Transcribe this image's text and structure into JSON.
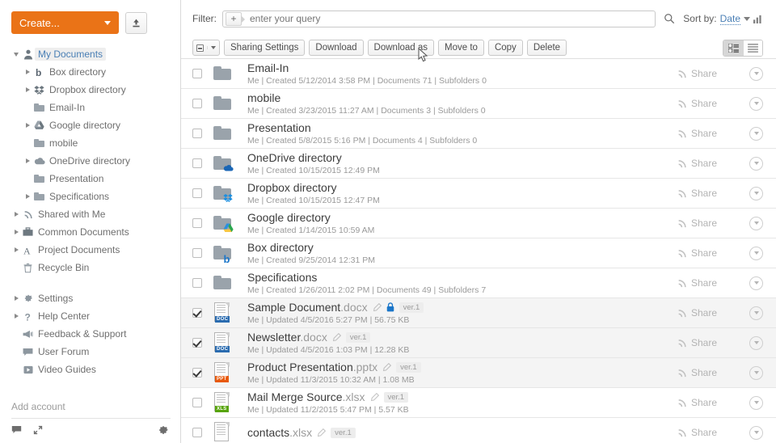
{
  "sidebar": {
    "create_button": {
      "label": "Create...",
      "color": "#ea7317"
    },
    "upload_button_name": "upload-icon",
    "tree": [
      {
        "label": "My Documents",
        "level": 1,
        "arrow": "down",
        "icon": "user-icon",
        "selected": true
      },
      {
        "label": "Box directory",
        "level": 2,
        "arrow": "right",
        "icon": "box-icon"
      },
      {
        "label": "Dropbox directory",
        "level": 2,
        "arrow": "right",
        "icon": "dropbox-icon"
      },
      {
        "label": "Email-In",
        "level": 2,
        "arrow": "none",
        "icon": "folder-icon"
      },
      {
        "label": "Google directory",
        "level": 2,
        "arrow": "right",
        "icon": "google-drive-icon"
      },
      {
        "label": "mobile",
        "level": 2,
        "arrow": "none",
        "icon": "folder-icon"
      },
      {
        "label": "OneDrive directory",
        "level": 2,
        "arrow": "right",
        "icon": "onedrive-icon"
      },
      {
        "label": "Presentation",
        "level": 2,
        "arrow": "none",
        "icon": "folder-icon"
      },
      {
        "label": "Specifications",
        "level": 2,
        "arrow": "right",
        "icon": "folder-icon"
      },
      {
        "label": "Shared with Me",
        "level": 1,
        "arrow": "right",
        "icon": "share-icon"
      },
      {
        "label": "Common Documents",
        "level": 1,
        "arrow": "right",
        "icon": "briefcase-icon"
      },
      {
        "label": "Project Documents",
        "level": 1,
        "arrow": "right",
        "icon": "project-icon"
      },
      {
        "label": "Recycle Bin",
        "level": 1,
        "arrow": "none",
        "icon": "trash-icon"
      }
    ],
    "tree_secondary": [
      {
        "label": "Settings",
        "level": 1,
        "arrow": "right",
        "icon": "gear-icon"
      },
      {
        "label": "Help Center",
        "level": 1,
        "arrow": "right",
        "icon": "question-icon"
      },
      {
        "label": "Feedback & Support",
        "level": 1,
        "arrow": "none",
        "icon": "megaphone-icon"
      },
      {
        "label": "User Forum",
        "level": 1,
        "arrow": "none",
        "icon": "chat-icon"
      },
      {
        "label": "Video Guides",
        "level": 1,
        "arrow": "none",
        "icon": "video-icon"
      }
    ],
    "add_account": "Add account",
    "footer_icons": [
      "chat-icon",
      "expand-icon",
      "gear-icon"
    ]
  },
  "toolbar": {
    "filter_label": "Filter:",
    "filter_placeholder": "enter your query",
    "filter_value": "",
    "plus_chip": "+",
    "search_icon": "search-icon",
    "sort_prefix": "Sort by:",
    "sort_value": "Date",
    "sort_order_icon": "sort-bars-icon",
    "select_all_icon": "checkbox-indeterminate-icon",
    "buttons": [
      "Sharing Settings",
      "Download",
      "Download as",
      "Move to",
      "Copy",
      "Delete"
    ],
    "view_detail_icon": "list-detail-view-icon",
    "view_list_icon": "list-compact-view-icon",
    "view_active": "detail"
  },
  "list": {
    "share_label": "Share",
    "rows": [
      {
        "name": "Email-In",
        "ext": "",
        "kind": "folder",
        "overlay": "none",
        "meta": "Me | Created 5/12/2014 3:58 PM | Documents 71 | Subfolders 0",
        "checked": false,
        "locked": false,
        "editable": false,
        "version": ""
      },
      {
        "name": "mobile",
        "ext": "",
        "kind": "folder",
        "overlay": "none",
        "meta": "Me | Created 3/23/2015 11:27 AM | Documents 3 | Subfolders 0",
        "checked": false,
        "locked": false,
        "editable": false,
        "version": ""
      },
      {
        "name": "Presentation",
        "ext": "",
        "kind": "folder",
        "overlay": "none",
        "meta": "Me | Created 5/8/2015 5:16 PM | Documents 4 | Subfolders 0",
        "checked": false,
        "locked": false,
        "editable": false,
        "version": ""
      },
      {
        "name": "OneDrive directory",
        "ext": "",
        "kind": "folder",
        "overlay": "onedrive",
        "meta": "Me | Created 10/15/2015 12:49 PM",
        "checked": false,
        "locked": false,
        "editable": false,
        "version": ""
      },
      {
        "name": "Dropbox directory",
        "ext": "",
        "kind": "folder",
        "overlay": "dropbox",
        "meta": "Me | Created 10/15/2015 12:47 PM",
        "checked": false,
        "locked": false,
        "editable": false,
        "version": ""
      },
      {
        "name": "Google directory",
        "ext": "",
        "kind": "folder",
        "overlay": "google",
        "meta": "Me | Created 1/14/2015 10:59 AM",
        "checked": false,
        "locked": false,
        "editable": false,
        "version": ""
      },
      {
        "name": "Box directory",
        "ext": "",
        "kind": "folder",
        "overlay": "box",
        "meta": "Me | Created 9/25/2014 12:31 PM",
        "checked": false,
        "locked": false,
        "editable": false,
        "version": ""
      },
      {
        "name": "Specifications",
        "ext": "",
        "kind": "folder",
        "overlay": "none",
        "meta": "Me | Created 1/26/2011 2:02 PM | Documents 49 | Subfolders 7",
        "checked": false,
        "locked": false,
        "editable": false,
        "version": ""
      },
      {
        "name": "Sample Document",
        "ext": ".docx",
        "kind": "doc",
        "overlay": "",
        "meta": "Me | Updated 4/5/2016 5:27 PM | 56.75 KB",
        "checked": true,
        "locked": true,
        "editable": true,
        "version": "ver.1"
      },
      {
        "name": "Newsletter",
        "ext": ".docx",
        "kind": "doc",
        "overlay": "",
        "meta": "Me | Updated 4/5/2016 1:03 PM | 12.28 KB",
        "checked": true,
        "locked": false,
        "editable": true,
        "version": "ver.1"
      },
      {
        "name": "Product Presentation",
        "ext": ".pptx",
        "kind": "ppt",
        "overlay": "",
        "meta": "Me | Updated 11/3/2015 10:32 AM | 1.08 MB",
        "checked": true,
        "locked": false,
        "editable": true,
        "version": "ver.1"
      },
      {
        "name": "Mail Merge Source",
        "ext": ".xlsx",
        "kind": "xls",
        "overlay": "",
        "meta": "Me | Updated 11/2/2015 5:47 PM | 5.57 KB",
        "checked": false,
        "locked": false,
        "editable": true,
        "version": "ver.1"
      },
      {
        "name": "contacts",
        "ext": ".xlsx",
        "kind": "xls-plain",
        "overlay": "",
        "meta": "",
        "checked": false,
        "locked": false,
        "editable": true,
        "version": "ver.1"
      }
    ]
  }
}
